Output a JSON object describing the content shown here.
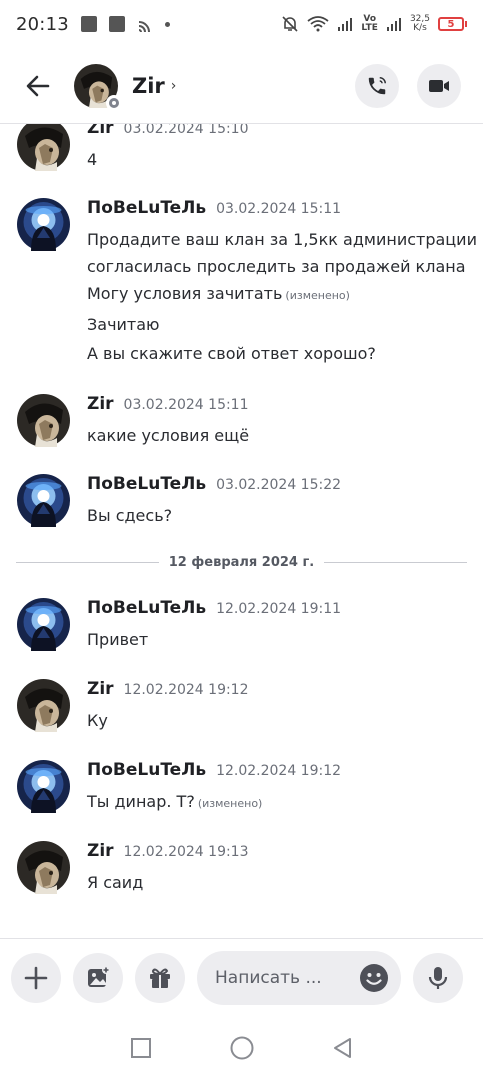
{
  "status_bar": {
    "time": "20:13",
    "network_top": "Vo",
    "network_bottom": "LTE",
    "speed_value": "32,5",
    "speed_unit": "K/s",
    "battery": "5"
  },
  "header": {
    "contact_name": "Zir",
    "chevron": "›",
    "back_icon": "arrow-left-icon",
    "call_icon": "phone-icon",
    "video_icon": "video-camera-icon"
  },
  "divider_date": "12 февраля 2024 г.",
  "messages": [
    {
      "author": "Zir",
      "avatar": "zir",
      "time": "03.02.2024 15:10",
      "lines": [
        {
          "text": "4",
          "edited": ""
        }
      ]
    },
    {
      "author": "ПоBeLuTeЛь",
      "avatar": "pob",
      "time": "03.02.2024 15:11",
      "lines": [
        {
          "text": "Продадите ваш клан за 1,5кк администрации",
          "edited": ""
        },
        {
          "text": "согласилась проследить за продажей клана",
          "edited": ""
        },
        {
          "text": "Могу условия зачитать",
          "edited": "(изменено)"
        },
        {
          "text": "Зачитаю",
          "edited": ""
        },
        {
          "text": "А вы скажите свой ответ хорошо?",
          "edited": ""
        }
      ]
    },
    {
      "author": "Zir",
      "avatar": "zir",
      "time": "03.02.2024 15:11",
      "lines": [
        {
          "text": "какие условия ещё",
          "edited": ""
        }
      ]
    },
    {
      "author": "ПоBeLuTeЛь",
      "avatar": "pob",
      "time": "03.02.2024 15:22",
      "lines": [
        {
          "text": "Вы сдесь?",
          "edited": ""
        }
      ]
    },
    {
      "author": "ПоBeLuTeЛь",
      "avatar": "pob",
      "time": "12.02.2024 19:11",
      "lines": [
        {
          "text": "Привет",
          "edited": ""
        }
      ]
    },
    {
      "author": "Zir",
      "avatar": "zir",
      "time": "12.02.2024 19:12",
      "lines": [
        {
          "text": "Ку",
          "edited": ""
        }
      ]
    },
    {
      "author": "ПоBeLuTeЛь",
      "avatar": "pob",
      "time": "12.02.2024 19:12",
      "lines": [
        {
          "text": "Ты динар. Т?",
          "edited": "(изменено)"
        }
      ]
    },
    {
      "author": "Zir",
      "avatar": "zir",
      "time": "12.02.2024 19:13",
      "lines": [
        {
          "text": "Я саид",
          "edited": ""
        }
      ]
    }
  ],
  "input_bar": {
    "placeholder": "Написать ...",
    "buttons": [
      "plus-icon",
      "image-icon",
      "gift-icon",
      "emoji-icon",
      "microphone-icon"
    ]
  },
  "nav_bar": [
    "recent-apps-icon",
    "home-icon",
    "back-triangle-icon"
  ],
  "colors": {
    "accent_bg": "#ededf0",
    "divider_line": "#c9cbd1",
    "battery_low": "#e04040",
    "pob_avatar_bg": "#1b2a52",
    "zir_avatar_bg": "#3a3530"
  }
}
